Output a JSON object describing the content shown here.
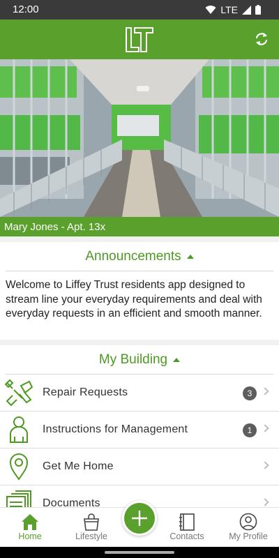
{
  "status_bar": {
    "time": "12:00",
    "network": "LTE"
  },
  "app_bar": {
    "logo_text": "LT",
    "accent_color": "#5aa02c"
  },
  "resident": {
    "label": "Mary Jones - Apt. 13x"
  },
  "announcements": {
    "title": "Announcements",
    "text": "Welcome to Liffey Trust residents app designed to stream line your everyday requirements and deal with everyday requests in an efficient and smooth manner."
  },
  "building": {
    "title": "My Building",
    "items": [
      {
        "label": "Repair Requests",
        "icon": "repair-icon",
        "badge": "3"
      },
      {
        "label": "Instructions for Management",
        "icon": "person-icon",
        "badge": "1"
      },
      {
        "label": "Get Me Home",
        "icon": "map-pin-icon",
        "badge": ""
      },
      {
        "label": "Documents",
        "icon": "documents-icon",
        "badge": ""
      }
    ]
  },
  "bottom_nav": {
    "items": [
      {
        "label": "Home",
        "icon": "home-icon",
        "active": true
      },
      {
        "label": "Lifestyle",
        "icon": "shopping-bag-icon",
        "active": false
      },
      {
        "label": "Contacts",
        "icon": "contacts-book-icon",
        "active": false
      },
      {
        "label": "My Profile",
        "icon": "profile-icon",
        "active": false
      }
    ],
    "fab_icon": "plus-icon"
  }
}
